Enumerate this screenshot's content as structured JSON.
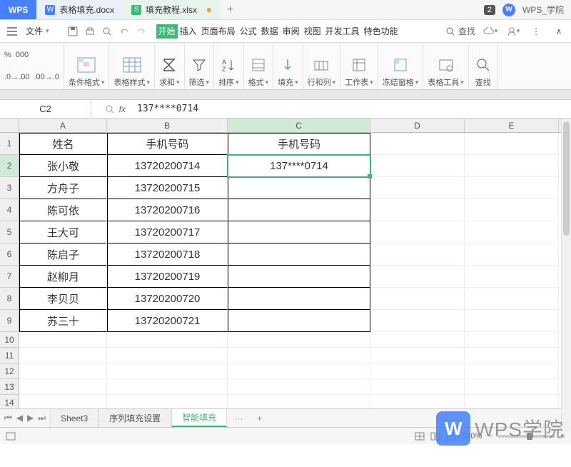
{
  "titlebar": {
    "app": "WPS",
    "tabs": [
      {
        "icon": "W",
        "label": "表格填充.docx"
      },
      {
        "icon": "S",
        "label": "填充教程.xlsx"
      }
    ],
    "badge": "2",
    "right_label": "WPS_学院"
  },
  "menu": {
    "file_label": "文件",
    "tabs": [
      "开始",
      "插入",
      "页面布局",
      "公式",
      "数据",
      "审阅",
      "视图",
      "开发工具",
      "特色功能"
    ],
    "active_tab": 0,
    "search_label": "查找"
  },
  "ribbon": {
    "left_mini": [
      "%",
      ".00",
      ".0"
    ],
    "groups": [
      {
        "label": "条件格式"
      },
      {
        "label": "表格样式"
      },
      {
        "label": "求和"
      },
      {
        "label": "筛选"
      },
      {
        "label": "排序"
      },
      {
        "label": "格式"
      },
      {
        "label": "填充"
      },
      {
        "label": "行和列"
      },
      {
        "label": "工作表"
      },
      {
        "label": "冻结窗格"
      },
      {
        "label": "表格工具"
      },
      {
        "label": "查找"
      }
    ]
  },
  "formula": {
    "name_box": "C2",
    "fx": "fx",
    "value": "137****0714"
  },
  "columns": [
    "A",
    "B",
    "C",
    "D",
    "E"
  ],
  "table": {
    "headers": [
      "姓名",
      "手机号码",
      "手机号码"
    ],
    "rows": [
      [
        "张小敬",
        "13720200714",
        "137****0714"
      ],
      [
        "方舟子",
        "13720200715",
        ""
      ],
      [
        "陈可依",
        "13720200716",
        ""
      ],
      [
        "王大可",
        "13720200717",
        ""
      ],
      [
        "陈启子",
        "13720200718",
        ""
      ],
      [
        "赵柳月",
        "13720200719",
        ""
      ],
      [
        "李贝贝",
        "13720200720",
        ""
      ],
      [
        "苏三十",
        "13720200721",
        ""
      ]
    ],
    "active_cell": "C2"
  },
  "sheets": {
    "tabs": [
      "Sheet3",
      "序列填充设置",
      "智能填充"
    ],
    "active": 2,
    "more": "···"
  },
  "status": {
    "zoom": "100%"
  },
  "watermark": {
    "logo": "W",
    "text": "WPS学院"
  }
}
